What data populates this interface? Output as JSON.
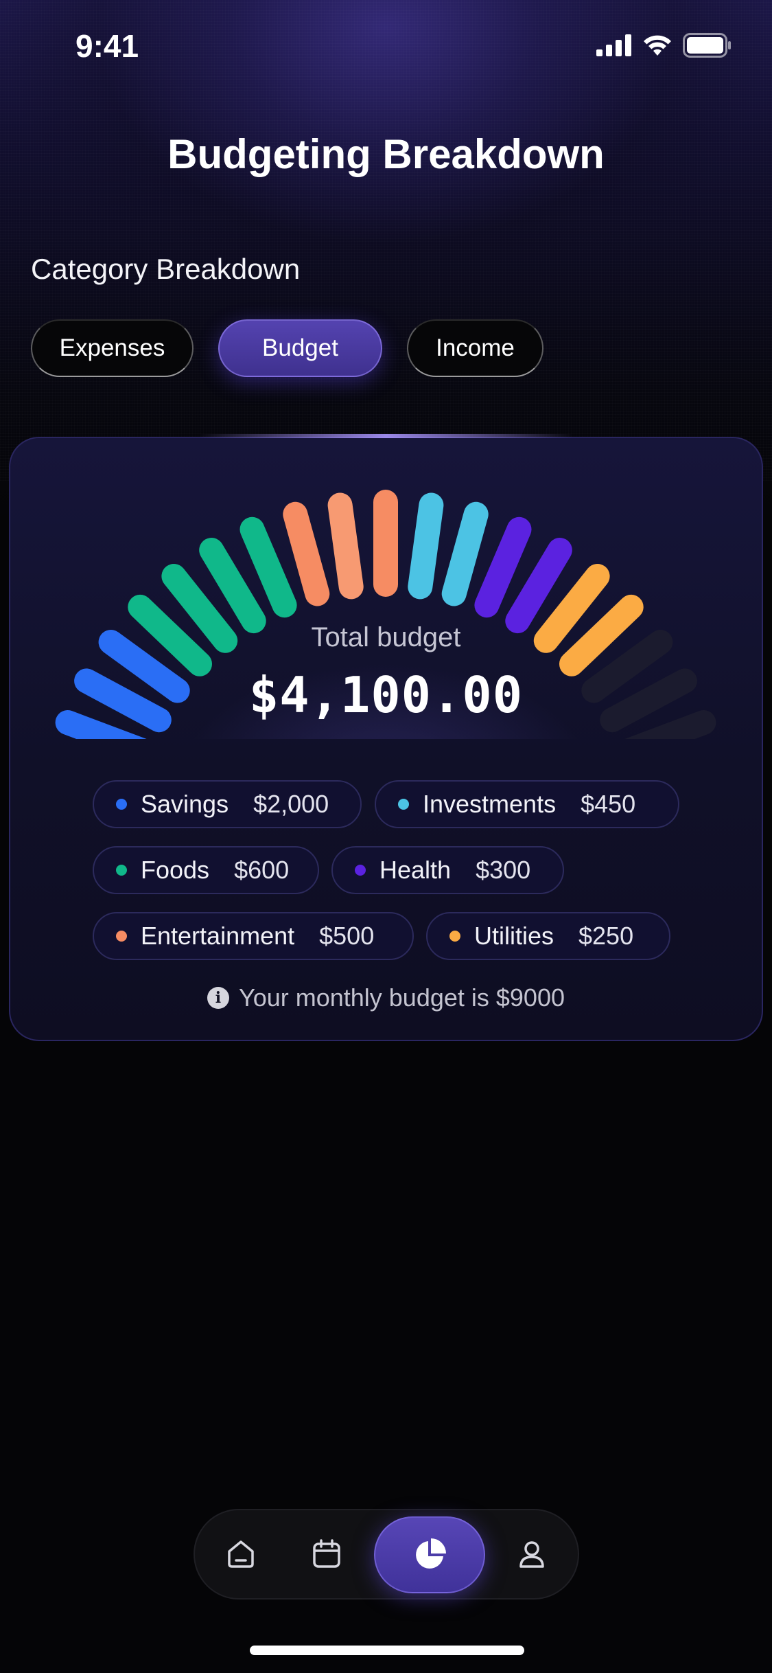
{
  "status_bar": {
    "time": "9:41"
  },
  "header": {
    "title": "Budgeting Breakdown"
  },
  "section": {
    "title": "Category Breakdown"
  },
  "tabs": [
    {
      "label": "Expenses",
      "active": false
    },
    {
      "label": "Budget",
      "active": true
    },
    {
      "label": "Income",
      "active": false
    }
  ],
  "budget_card": {
    "total_label": "Total budget",
    "total_value": "$4,100.00",
    "note": "Your monthly budget is $9000",
    "categories": [
      {
        "name": "Savings",
        "amount": "$2,000",
        "color": "#2a6ef5"
      },
      {
        "name": "Investments",
        "amount": "$450",
        "color": "#4cc3e4"
      },
      {
        "name": "Foods",
        "amount": "$600",
        "color": "#10b88a"
      },
      {
        "name": "Health",
        "amount": "$300",
        "color": "#5b22e0"
      },
      {
        "name": "Entertainment",
        "amount": "$500",
        "color": "#f68c63"
      },
      {
        "name": "Utilities",
        "amount": "$250",
        "color": "#fbab44"
      }
    ],
    "gauge": {
      "total_segments": 24,
      "segment_colors": [
        "#2a6ef5",
        "#2a6ef5",
        "#2a6ef5",
        "#2a6ef5",
        "#2a6ef5",
        "#10b88a",
        "#10b88a",
        "#10b88a",
        "#10b88a",
        "#f68c63",
        "#f79a72",
        "#f68c63",
        "#4cc3e4",
        "#4cc3e4",
        "#5b22e0",
        "#5b22e0",
        "#fbab44",
        "#fbab44",
        "#1b1b2e",
        "#1b1b2e",
        "#1b1b2e",
        "#1b1b2e",
        "#1b1b2e"
      ]
    }
  },
  "bottom_nav": {
    "items": [
      {
        "icon": "home-icon",
        "active": false
      },
      {
        "icon": "calendar-icon",
        "active": false
      },
      {
        "icon": "pie-chart-icon",
        "active": true
      },
      {
        "icon": "profile-icon",
        "active": false
      }
    ]
  },
  "colors": {
    "accent": "#4a3aa8",
    "background": "#050507",
    "card": "#12112e"
  }
}
